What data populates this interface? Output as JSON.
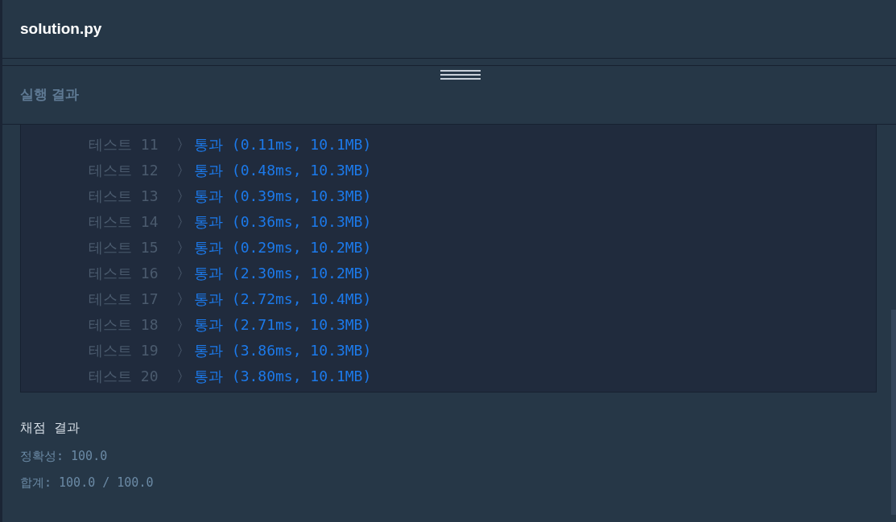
{
  "file_tab": {
    "title": "solution.py"
  },
  "output_panel": {
    "title": "실행 결과",
    "results": [
      {
        "label": "테스트 11",
        "separator": "〉",
        "result": "통과 (0.11ms, 10.1MB)"
      },
      {
        "label": "테스트 12",
        "separator": "〉",
        "result": "통과 (0.48ms, 10.3MB)"
      },
      {
        "label": "테스트 13",
        "separator": "〉",
        "result": "통과 (0.39ms, 10.3MB)"
      },
      {
        "label": "테스트 14",
        "separator": "〉",
        "result": "통과 (0.36ms, 10.3MB)"
      },
      {
        "label": "테스트 15",
        "separator": "〉",
        "result": "통과 (0.29ms, 10.2MB)"
      },
      {
        "label": "테스트 16",
        "separator": "〉",
        "result": "통과 (2.30ms, 10.2MB)"
      },
      {
        "label": "테스트 17",
        "separator": "〉",
        "result": "통과 (2.72ms, 10.4MB)"
      },
      {
        "label": "테스트 18",
        "separator": "〉",
        "result": "통과 (2.71ms, 10.3MB)"
      },
      {
        "label": "테스트 19",
        "separator": "〉",
        "result": "통과 (3.86ms, 10.3MB)"
      },
      {
        "label": "테스트 20",
        "separator": "〉",
        "result": "통과 (3.80ms, 10.1MB)"
      }
    ],
    "grading": {
      "title": "채점 결과",
      "lines": [
        "정확성: 100.0",
        "합계: 100.0 / 100.0"
      ]
    }
  }
}
